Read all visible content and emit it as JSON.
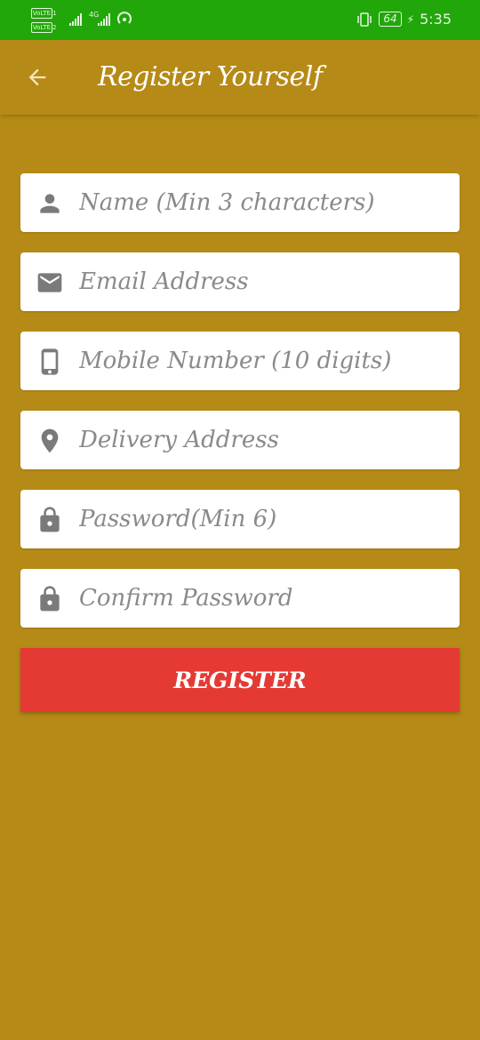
{
  "status_bar": {
    "volte_1": "VoLTE",
    "volte_2": "VoLTE",
    "sim_1": "1",
    "sim_2": "2",
    "network": "4G",
    "battery": "64",
    "time": "5:35"
  },
  "app_bar": {
    "title": "Register Yourself"
  },
  "form": {
    "name_placeholder": "Name (Min 3 characters)",
    "email_placeholder": "Email Address",
    "mobile_placeholder": "Mobile Number (10 digits)",
    "address_placeholder": "Delivery Address",
    "password_placeholder": "Password(Min 6)",
    "confirm_password_placeholder": "Confirm Password",
    "register_label": "REGISTER"
  },
  "icons": {
    "back": "arrow-left",
    "name": "person",
    "email": "envelope",
    "mobile": "smartphone",
    "address": "location-pin",
    "password": "lock",
    "confirm_password": "lock"
  },
  "colors": {
    "background": "#b68a16",
    "status_bar": "#21a70a",
    "register_button": "#e53a34",
    "icon_gray": "#7a7a7a"
  }
}
